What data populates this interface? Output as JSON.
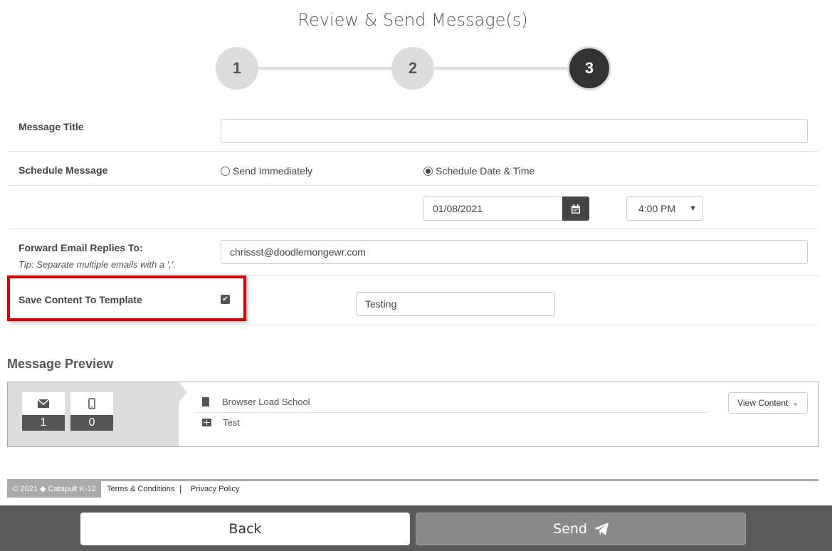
{
  "page": {
    "title": "Review & Send Message(s)"
  },
  "steps": [
    {
      "label": "1"
    },
    {
      "label": "2"
    },
    {
      "label": "3",
      "active": true
    }
  ],
  "form": {
    "message_title": {
      "label": "Message Title",
      "value": ""
    },
    "schedule": {
      "label": "Schedule Message",
      "options": [
        "Send Immediately",
        "Schedule Date & Time"
      ],
      "selected": "Schedule Date & Time",
      "date": "01/08/2021",
      "time": "4:00 PM"
    },
    "forward": {
      "label": "Forward Email Replies To:",
      "tip": "Tip: Separate multiple emails with a ','.",
      "value": "chrissst@doodlemongewr.com"
    },
    "template": {
      "label": "Save Content To Template",
      "checked": true,
      "name": "Testing"
    }
  },
  "preview": {
    "heading": "Message Preview",
    "email_count": "1",
    "sms_count": "0",
    "school": "Browser Load School",
    "group": "Test",
    "view_button": "View Content"
  },
  "footer": {
    "copyright": "© 2021 ◆ Catapult K-12",
    "terms": "Terms & Conditions",
    "separator": "|",
    "privacy": "Privacy Policy"
  },
  "actions": {
    "back": "Back",
    "send": "Send"
  },
  "colors": {
    "highlight": "#e00000",
    "dark": "#333333",
    "send_disabled": "#8a8a8a"
  }
}
